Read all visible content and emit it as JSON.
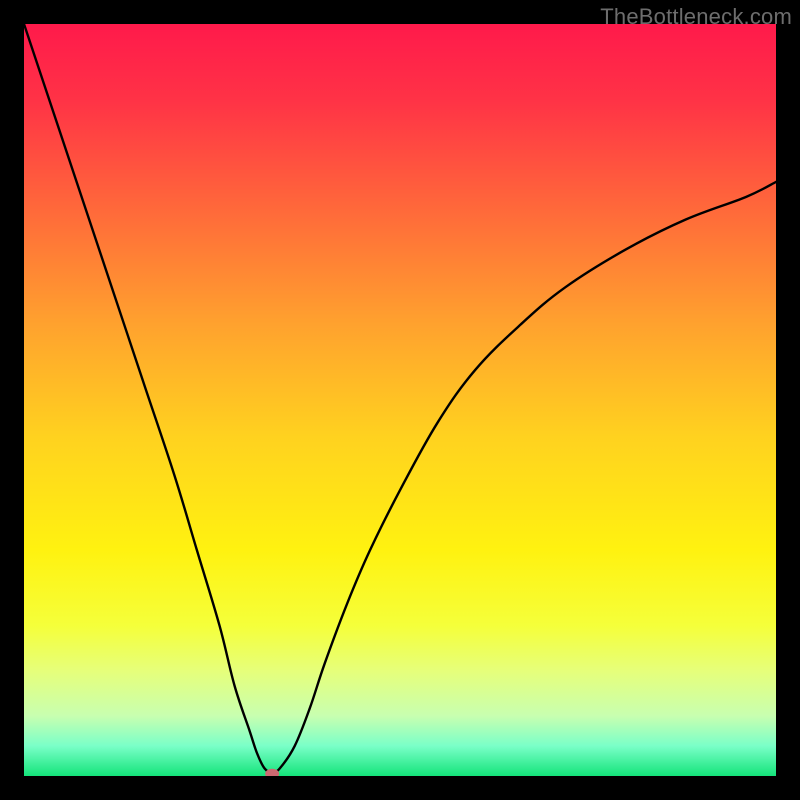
{
  "watermark": "TheBottleneck.com",
  "chart_data": {
    "type": "line",
    "title": "",
    "xlabel": "",
    "ylabel": "",
    "xlim": [
      0,
      100
    ],
    "ylim": [
      0,
      100
    ],
    "grid": false,
    "background_gradient_stops": [
      {
        "offset": 0.0,
        "color": "#ff1a4b"
      },
      {
        "offset": 0.1,
        "color": "#ff3246"
      },
      {
        "offset": 0.25,
        "color": "#ff6a3a"
      },
      {
        "offset": 0.4,
        "color": "#ffa22e"
      },
      {
        "offset": 0.55,
        "color": "#ffd21f"
      },
      {
        "offset": 0.7,
        "color": "#fff210"
      },
      {
        "offset": 0.8,
        "color": "#f5ff3a"
      },
      {
        "offset": 0.86,
        "color": "#e6ff7a"
      },
      {
        "offset": 0.92,
        "color": "#c8ffb0"
      },
      {
        "offset": 0.96,
        "color": "#7affc8"
      },
      {
        "offset": 1.0,
        "color": "#14e47a"
      }
    ],
    "series": [
      {
        "name": "bottleneck-curve",
        "x": [
          0,
          4,
          8,
          12,
          16,
          20,
          23,
          26,
          28,
          30,
          31,
          32,
          33,
          34,
          36,
          38,
          40,
          43,
          46,
          50,
          55,
          60,
          66,
          72,
          80,
          88,
          96,
          100
        ],
        "y": [
          100,
          88,
          76,
          64,
          52,
          40,
          30,
          20,
          12,
          6,
          3,
          1,
          0.5,
          1,
          4,
          9,
          15,
          23,
          30,
          38,
          47,
          54,
          60,
          65,
          70,
          74,
          77,
          79
        ]
      }
    ],
    "markers": [
      {
        "name": "min-point",
        "x": 33,
        "y": 0.3,
        "color": "#cc6a72",
        "rx": 7,
        "ry": 5
      }
    ]
  }
}
